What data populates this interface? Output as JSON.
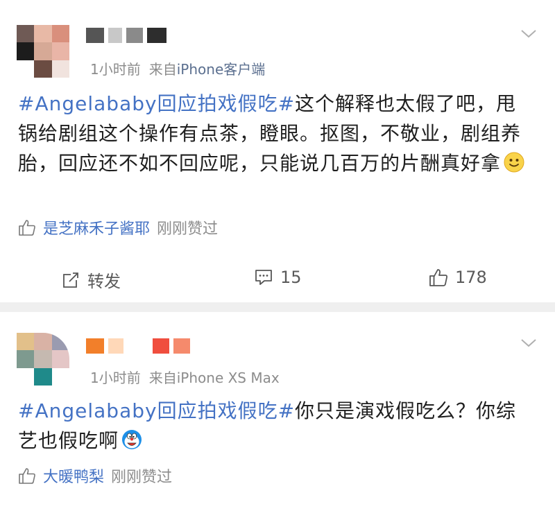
{
  "posts": [
    {
      "avatar_colors": [
        "#6f5a55",
        "#e8b9a6",
        "#d98f7c",
        "#1c1c1c",
        "#d6a996",
        "#e9b5a7",
        "#ffffff",
        "#6b4c42",
        "#f1e3de"
      ],
      "name_colors": [
        "#555555",
        "#c8c8c8",
        "#8a8a8a",
        "#2d2d2d"
      ],
      "time": "1小时前",
      "source_prefix": "来自",
      "client": "iPhone客户端",
      "topic": "#Angelababy回应拍戏假吃#",
      "text": "这个解释也太假了吧，甩锅给剧组这个操作有点茶，瞪眼。抠图，不敬业，剧组养胎，回应还不如不回应呢，只能说几百万的片酬真好拿",
      "emoji": "smile-emoji",
      "liker_name": "是芝麻禾子酱耶",
      "liker_time": "刚刚赞过",
      "forward_label": "转发",
      "comment_count": "15",
      "like_count": "178"
    },
    {
      "avatar_colors": [
        "#e2c08a",
        "#d9b2a5",
        "#9a9bb0",
        "#7e9a8f",
        "#c5b9b0",
        "#e4c6c6",
        "#ffffff",
        "#1f8a8a",
        "#ffffff"
      ],
      "name_colors": [
        "#f27f2a",
        "#ffd8b8",
        "#ffffff",
        "#f04e3e",
        "#f58a6c"
      ],
      "time": "1小时前",
      "source_prefix": "来自",
      "client": "iPhone XS Max",
      "topic": "#Angelababy回应拍戏假吃#",
      "text": "你只是演戏假吃么？你综艺也假吃啊",
      "emoji": "doraemon-emoji",
      "liker_name": "大暖鸭梨",
      "liker_time": "刚刚赞过"
    }
  ]
}
